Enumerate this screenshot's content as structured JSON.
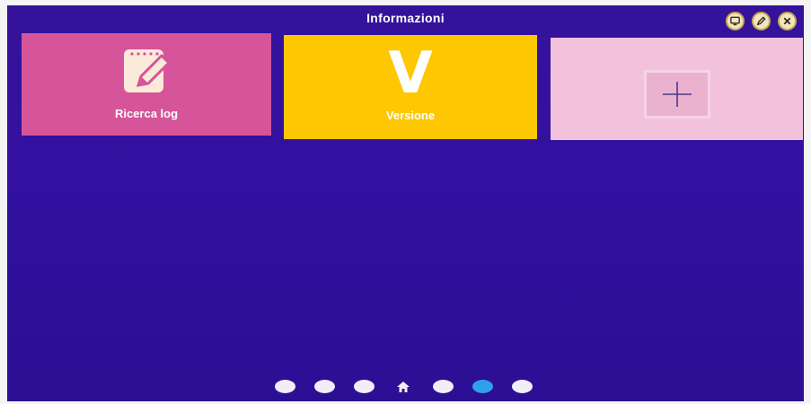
{
  "header": {
    "title": "Informazioni"
  },
  "top_actions": [
    {
      "name": "monitor-icon",
      "color": "#efe6c2"
    },
    {
      "name": "edit-icon",
      "color": "#efe6c2"
    },
    {
      "name": "close-icon",
      "color": "#efe6c2"
    }
  ],
  "tiles": [
    {
      "label": "Ricerca log",
      "icon": "notepad-pencil-icon",
      "color": "#d5549a"
    },
    {
      "label": "Versione",
      "icon_text": "V",
      "color": "#fdc701"
    },
    {
      "label": "",
      "icon": "plus-icon",
      "color": "#f2c2dc"
    }
  ],
  "pager": {
    "pages": 7,
    "home_index": 3,
    "active_index": 5,
    "active_color": "#2fa0ea"
  },
  "colors": {
    "background": "#35129a"
  }
}
